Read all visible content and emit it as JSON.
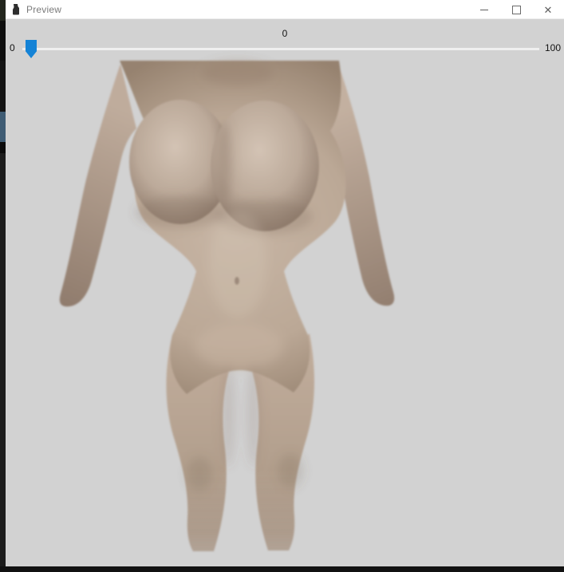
{
  "titlebar": {
    "title": "Preview",
    "controls": [
      {
        "name": "minimize"
      },
      {
        "name": "maximize"
      },
      {
        "name": "close",
        "glyph": "✕"
      }
    ]
  },
  "slider": {
    "value": "0",
    "min": "0",
    "max": "100"
  },
  "viewport": {
    "alt": "3D female character model, front view, cropped at upper chest and shins"
  },
  "colors": {
    "accent_blue": "#1583d6",
    "titlebar_bg": "#ffffff",
    "title_text": "#7a7a7a",
    "content_bg": "#d2d2d2",
    "slider_track": "#efefef",
    "skin_base": "#b9a695",
    "skin_highlight": "#d3c3b4",
    "skin_shadow": "#8e7a6b",
    "desktop_edge": "#141414",
    "desktop_edge_blue": "#3f5c74"
  }
}
